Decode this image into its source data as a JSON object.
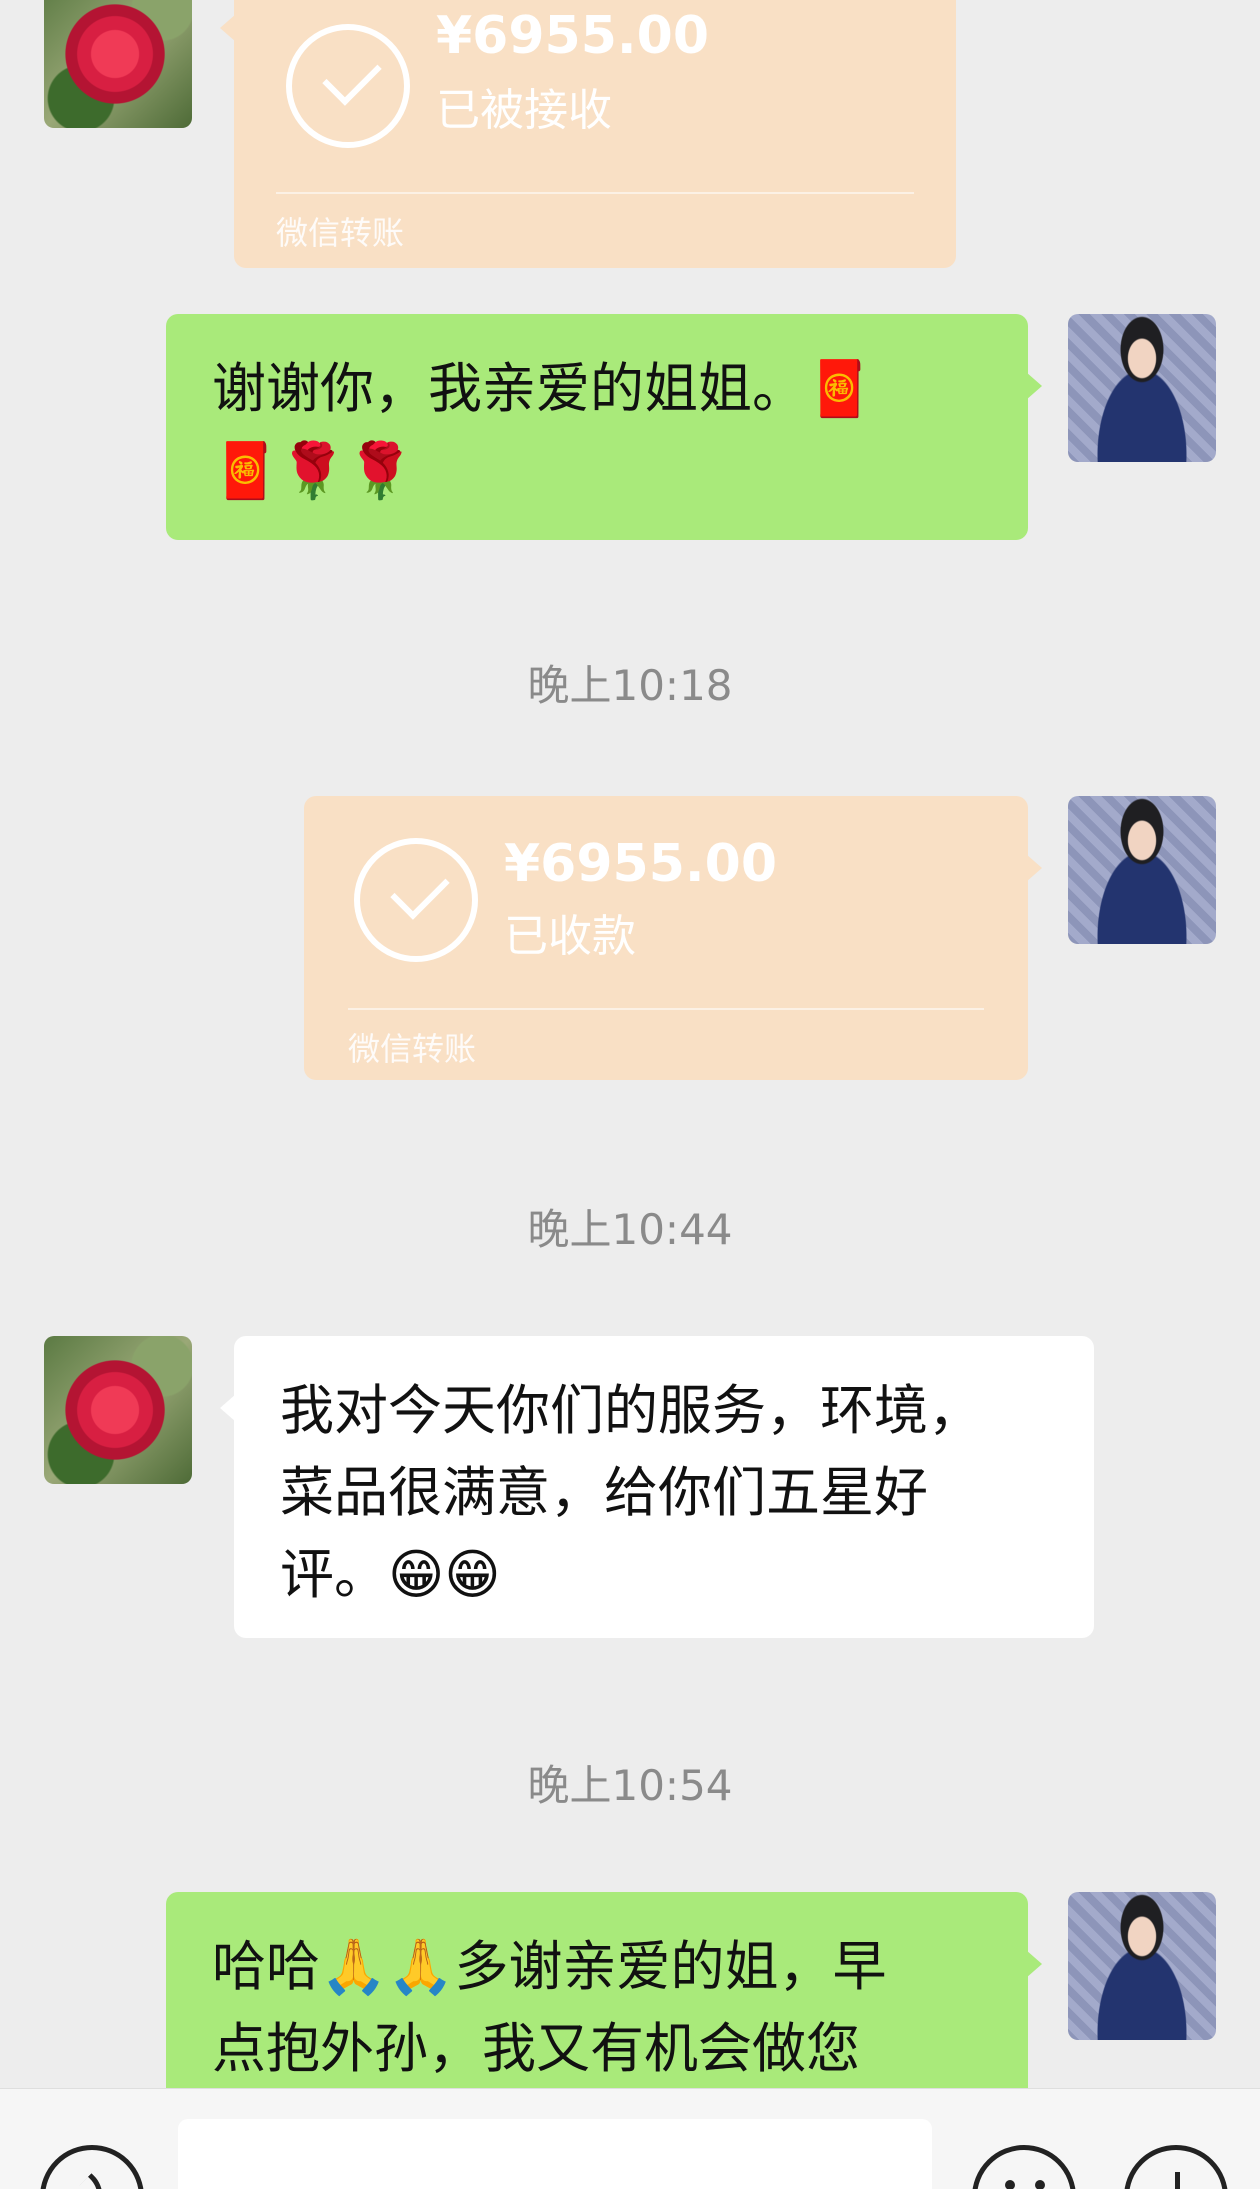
{
  "transfers": [
    {
      "amount": "¥6955.00",
      "status": "已被接收",
      "brand": "微信转账"
    },
    {
      "amount": "¥6955.00",
      "status": "已收款",
      "brand": "微信转账"
    }
  ],
  "messages": {
    "m1": "谢谢你，我亲爱的姐姐。🧧\n🧧🌹🌹",
    "m2": "我对今天你们的服务，环境，\n菜品很满意，给你们五星好\n评。😁😁",
    "m3": "哈哈🙏🙏多谢亲爱的姐，早\n点抱外孙，我又有机会做您"
  },
  "timestamps": [
    "晚上10:18",
    "晚上10:44",
    "晚上10:54"
  ],
  "icons": {
    "voice": "voice-icon",
    "emoji": "emoji-icon",
    "more": "plus-icon"
  },
  "colors": {
    "background": "#ededed",
    "sent_bubble": "#a9ea7a",
    "received_bubble": "#ffffff",
    "transfer_card": "#f9e0c5"
  }
}
